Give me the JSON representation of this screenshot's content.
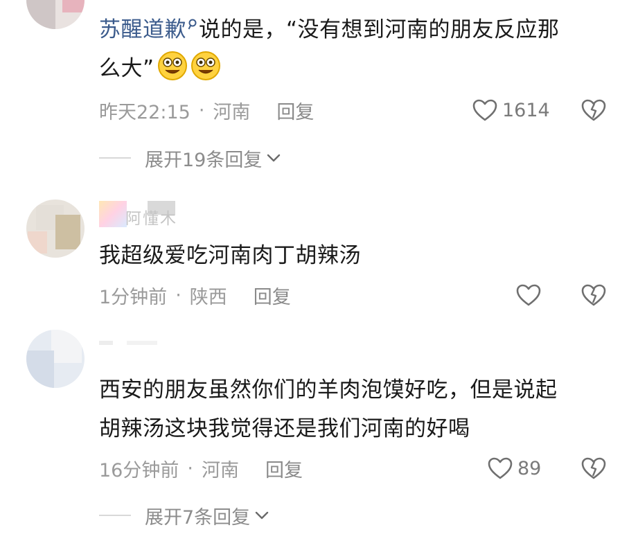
{
  "comments": [
    {
      "author": "苏醒道歉",
      "text_after": "说的是，“没有想到河南的朋友反应那",
      "text_line2": "么大”",
      "emoji": [
        "smile-emoji",
        "smile-emoji"
      ],
      "time": "昨天22:15",
      "location": "河南",
      "reply_label": "回复",
      "likes": "1614",
      "expand_label": "展开19条回复"
    },
    {
      "author": "阿懂木",
      "text": "我超级爱吃河南肉丁胡辣汤",
      "time": "1分钟前",
      "location": "陕西",
      "reply_label": "回复",
      "likes": ""
    },
    {
      "author": "",
      "text_line1": "西安的朋友虽然你们的羊肉泡馍好吃，但是说起",
      "text_line2": "胡辣汤这块我觉得还是我们河南的好喝",
      "time": "16分钟前",
      "location": "河南",
      "reply_label": "回复",
      "likes": "89",
      "expand_label": "展开7条回复"
    }
  ],
  "separator": "·",
  "colors": {
    "mention": "#3b5b8c",
    "meta": "#9a9a9a",
    "icon": "#7a7a7a"
  }
}
